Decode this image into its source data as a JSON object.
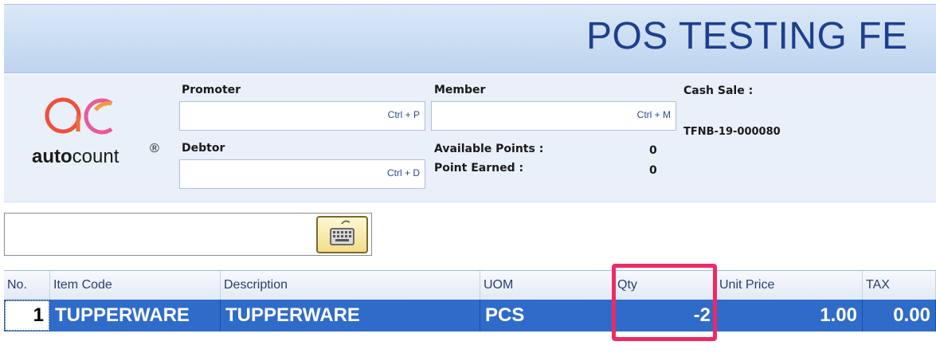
{
  "header": {
    "title": "POS TESTING FE"
  },
  "logo": {
    "brand_bold": "auto",
    "brand_rest": "count",
    "registered": "®"
  },
  "info": {
    "promoter_label": "Promoter",
    "promoter_shortcut": "Ctrl + P",
    "debtor_label": "Debtor",
    "debtor_shortcut": "Ctrl + D",
    "member_label": "Member",
    "member_shortcut": "Ctrl + M",
    "available_points_label": "Available Points :",
    "available_points_value": "0",
    "point_earned_label": "Point Earned :",
    "point_earned_value": "0",
    "cash_sale_label": "Cash Sale :",
    "cash_sale_doc": "TFNB-19-000080"
  },
  "search": {
    "value": "",
    "keyboard_icon": "keyboard-icon"
  },
  "grid": {
    "columns": [
      "No.",
      "Item Code",
      "Description",
      "UOM",
      "Qty",
      "Unit Price",
      "TAX"
    ],
    "rows": [
      {
        "no": "1",
        "item_code": "TUPPERWARE",
        "description": "TUPPERWARE",
        "uom": "PCS",
        "qty": "-2",
        "unit_price": "1.00",
        "tax": "0.00"
      }
    ]
  },
  "colors": {
    "accent": "#2f6bc9",
    "highlight": "#ee2a66",
    "title": "#1e3f8f"
  }
}
